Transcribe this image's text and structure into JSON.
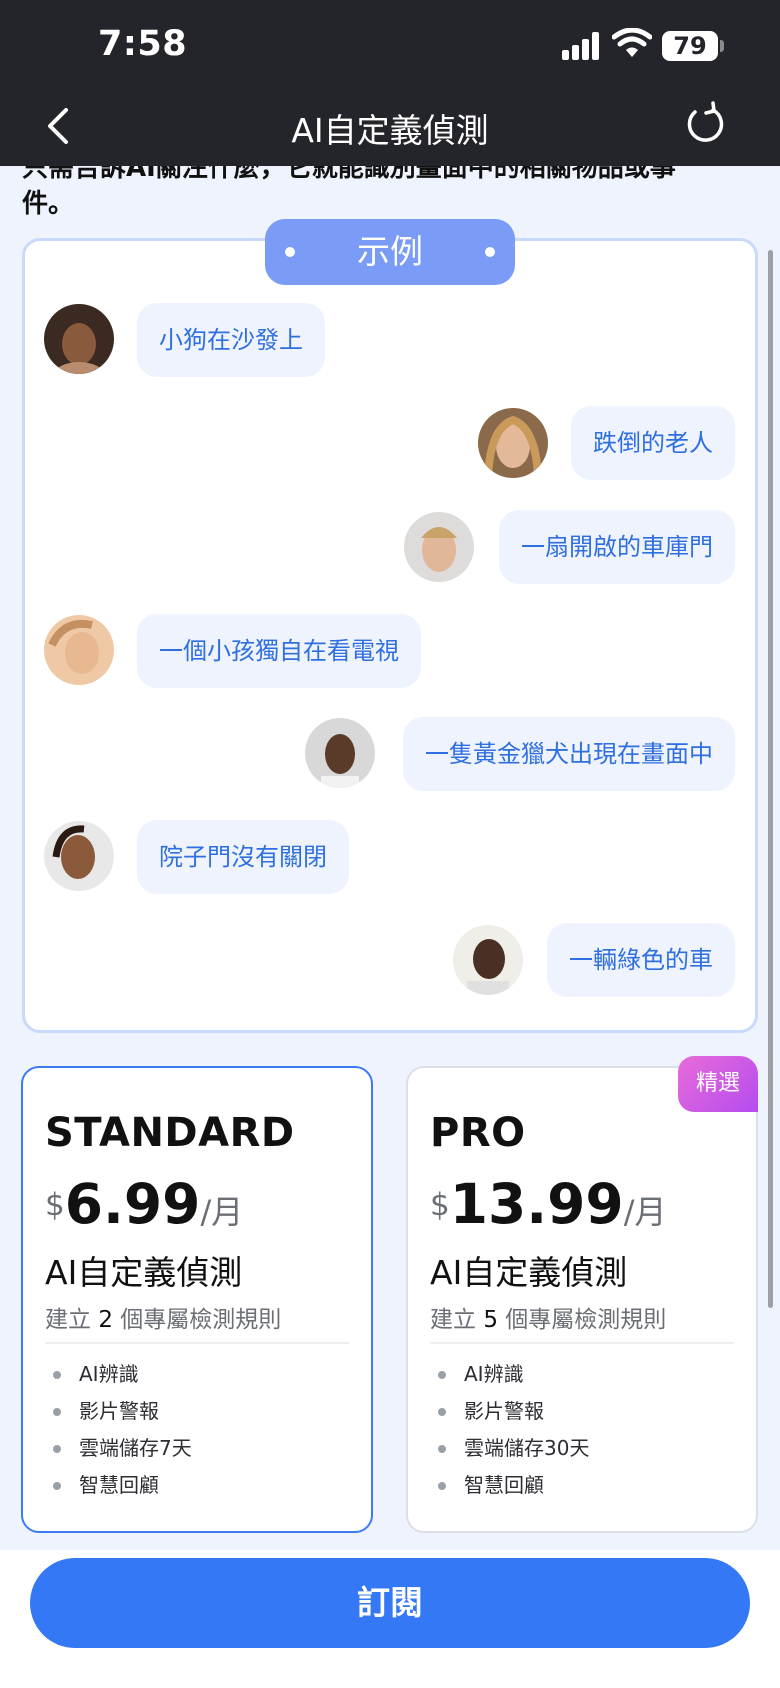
{
  "status": {
    "time": "7:58",
    "battery": "79"
  },
  "nav": {
    "title": "AI自定義偵測",
    "back_icon": "chevron-left-icon",
    "refresh_icon": "refresh-icon"
  },
  "intro": {
    "line1": "只需告訴AI關注什麼，它就能識別畫面中的相關物品或事",
    "line2": "件。"
  },
  "example": {
    "tag": "示例",
    "messages": [
      {
        "text": "小狗在沙發上",
        "side": "left"
      },
      {
        "text": "跌倒的老人",
        "side": "right"
      },
      {
        "text": "一扇開啟的車庫門",
        "side": "right"
      },
      {
        "text": "一個小孩獨自在看電視",
        "side": "left"
      },
      {
        "text": "一隻黃金獵犬出現在畫面中",
        "side": "right"
      },
      {
        "text": "院子門沒有關閉",
        "side": "left"
      },
      {
        "text": "一輛綠色的車",
        "side": "right"
      }
    ]
  },
  "plans": {
    "standard": {
      "name": "STANDARD",
      "currency": "$",
      "price": "6.99",
      "period": "/月",
      "feature": "AI自定義偵測",
      "desc_pre": "建立",
      "desc_num": "2",
      "desc_post": "個專屬檢測規則",
      "items": [
        "AI辨識",
        "影片警報",
        "雲端儲存7天",
        "智慧回顧"
      ]
    },
    "pro": {
      "name": "PRO",
      "currency": "$",
      "price": "13.99",
      "period": "/月",
      "feature": "AI自定義偵測",
      "desc_pre": "建立",
      "desc_num": "5",
      "desc_post": "個專屬檢測規則",
      "items": [
        "AI辨識",
        "影片警報",
        "雲端儲存30天",
        "智慧回顧"
      ],
      "badge": "精選"
    }
  },
  "subscribe_label": "訂閱",
  "colors": {
    "accent": "#3478f6",
    "bubble_text": "#2f6fe0",
    "example_tag": "#7b9cf6",
    "badge": "#c45be8"
  }
}
